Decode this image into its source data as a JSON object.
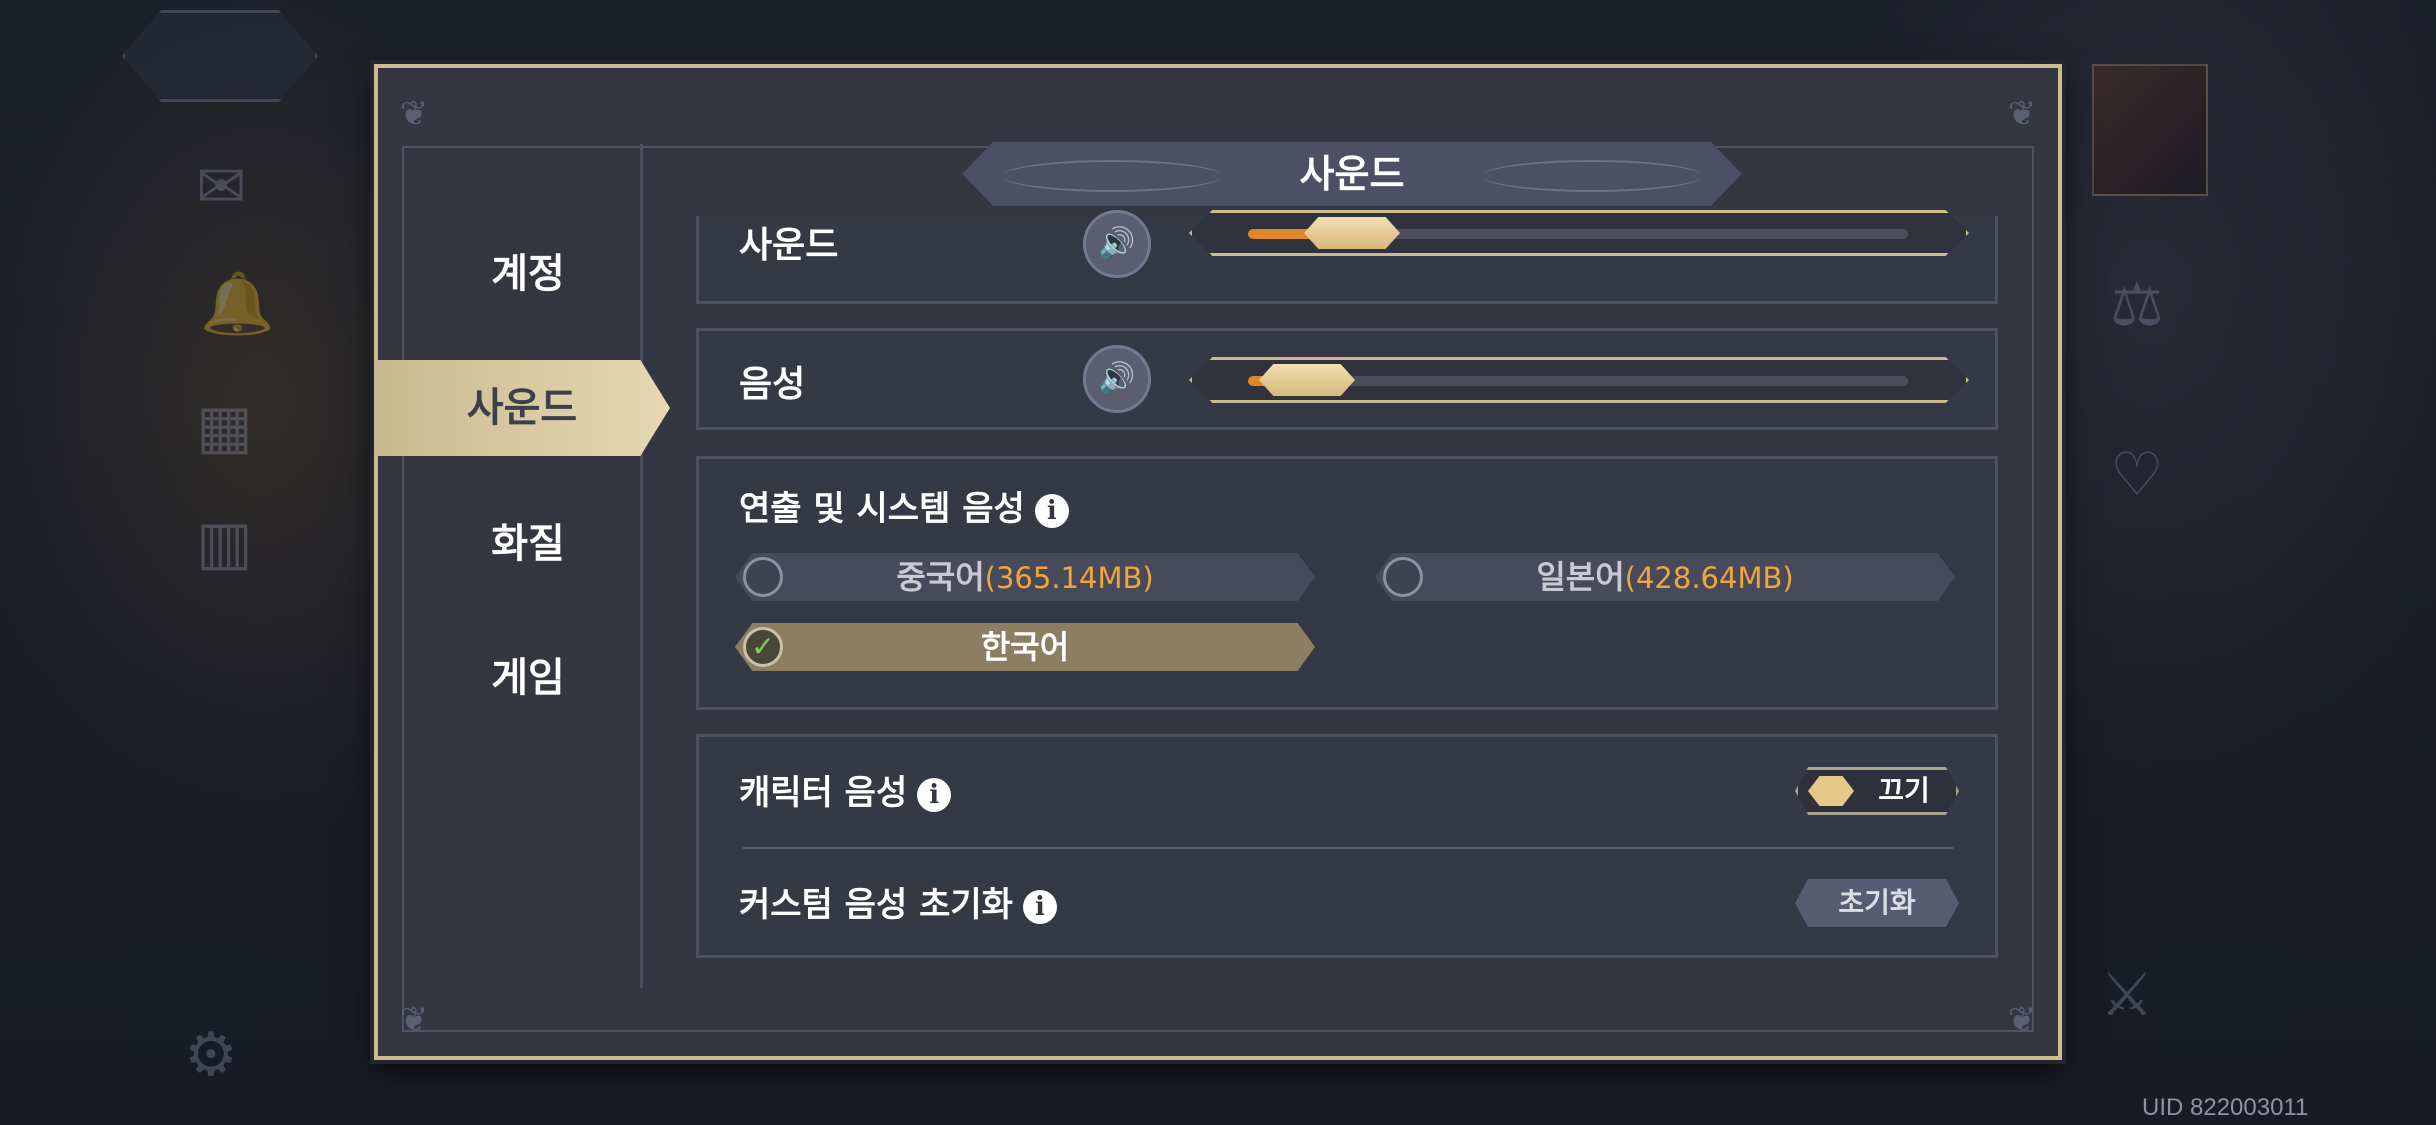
{
  "background": {
    "uid_text": "UID 822003011"
  },
  "dialog": {
    "title": "사운드",
    "nav": [
      {
        "label": "계정",
        "active": false
      },
      {
        "label": "사운드",
        "active": true
      },
      {
        "label": "화질",
        "active": false
      },
      {
        "label": "게임",
        "active": false
      }
    ],
    "volume_rows": [
      {
        "label": "사운드",
        "icon": "speaker-icon",
        "level": 0.1
      },
      {
        "label": "음성",
        "icon": "speaker-icon",
        "level": 0.02
      }
    ],
    "system_voice": {
      "heading": "연출 및 시스템 음성",
      "info_glyph": "i",
      "options": [
        {
          "name": "중국어",
          "size": "(365.14MB)",
          "selected": false
        },
        {
          "name": "일본어",
          "size": "(428.64MB)",
          "selected": false
        },
        {
          "name": "한국어",
          "size": "",
          "selected": true
        }
      ]
    },
    "character_voice": {
      "label": "캐릭터 음성",
      "toggle_label": "끄기",
      "toggle_on": false
    },
    "custom_reset": {
      "label": "커스텀 음성 초기화",
      "button_label": "초기화"
    }
  },
  "colors": {
    "accent_gold": "#cdbd8e",
    "slider_fill": "#e0852a",
    "size_text": "#f0a63a",
    "check_green": "#7cd35b"
  }
}
